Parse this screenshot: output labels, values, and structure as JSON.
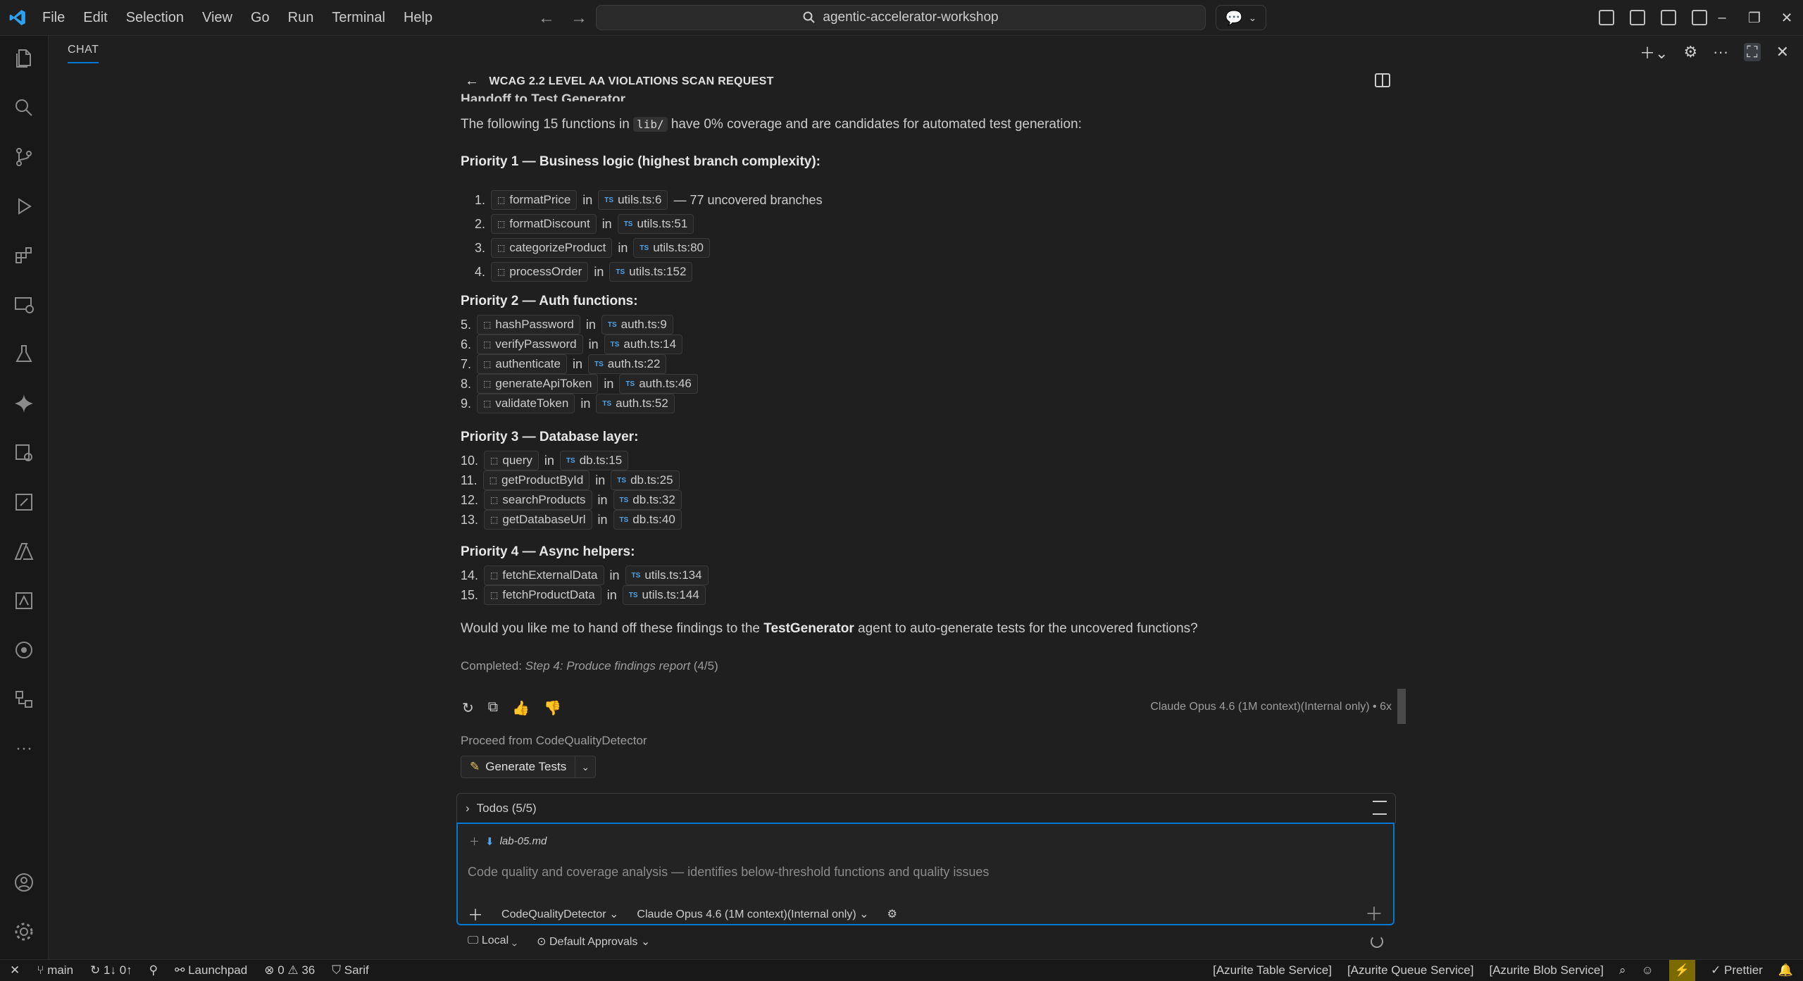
{
  "titlebar": {
    "menu": [
      "File",
      "Edit",
      "Selection",
      "View",
      "Go",
      "Run",
      "Terminal",
      "Help"
    ],
    "search_text": "agentic-accelerator-workshop"
  },
  "chat": {
    "tab_label": "CHAT",
    "session_title": "WCAG 2.2 LEVEL AA VIOLATIONS SCAN REQUEST",
    "partial_heading": "Handoff to Test Generator",
    "intro_pre": "The following 15 functions in ",
    "intro_code": "lib/",
    "intro_post": " have 0% coverage and are candidates for automated test generation:",
    "priority1_heading": "Priority 1 — Business logic (highest branch complexity):",
    "priority2_heading": "Priority 2 — Auth functions:",
    "priority3_heading": "Priority 3 — Database layer:",
    "priority4_heading": "Priority 4 — Async helpers:",
    "in_word": "in",
    "items": [
      {
        "num": "1.",
        "fn": "formatPrice",
        "file": "utils.ts:6",
        "note": "— 77 uncovered branches"
      },
      {
        "num": "2.",
        "fn": "formatDiscount",
        "file": "utils.ts:51",
        "note": ""
      },
      {
        "num": "3.",
        "fn": "categorizeProduct",
        "file": "utils.ts:80",
        "note": ""
      },
      {
        "num": "4.",
        "fn": "processOrder",
        "file": "utils.ts:152",
        "note": ""
      },
      {
        "num": "5.",
        "fn": "hashPassword",
        "file": "auth.ts:9",
        "note": ""
      },
      {
        "num": "6.",
        "fn": "verifyPassword",
        "file": "auth.ts:14",
        "note": ""
      },
      {
        "num": "7.",
        "fn": "authenticate",
        "file": "auth.ts:22",
        "note": ""
      },
      {
        "num": "8.",
        "fn": "generateApiToken",
        "file": "auth.ts:46",
        "note": ""
      },
      {
        "num": "9.",
        "fn": "validateToken",
        "file": "auth.ts:52",
        "note": ""
      },
      {
        "num": "10.",
        "fn": "query",
        "file": "db.ts:15",
        "note": ""
      },
      {
        "num": "11.",
        "fn": "getProductById",
        "file": "db.ts:25",
        "note": ""
      },
      {
        "num": "12.",
        "fn": "searchProducts",
        "file": "db.ts:32",
        "note": ""
      },
      {
        "num": "13.",
        "fn": "getDatabaseUrl",
        "file": "db.ts:40",
        "note": ""
      },
      {
        "num": "14.",
        "fn": "fetchExternalData",
        "file": "utils.ts:134",
        "note": ""
      },
      {
        "num": "15.",
        "fn": "fetchProductData",
        "file": "utils.ts:144",
        "note": ""
      }
    ],
    "question_pre": "Would you like me to hand off these findings to the ",
    "question_bold": "TestGenerator",
    "question_post": " agent to auto-generate tests for the uncovered functions?",
    "completed_label": "Completed: ",
    "completed_step": "Step 4: Produce findings report",
    "completed_count": " (4/5)",
    "model_note": "Claude Opus 4.6 (1M context)(Internal only) • 6x",
    "proceed_text": "Proceed from CodeQualityDetector",
    "generate_button": "Generate Tests"
  },
  "input": {
    "todos_label": "Todos (5/5)",
    "attachment": "lab-05.md",
    "placeholder": "Code quality and coverage analysis — identifies below-threshold functions and quality issues",
    "agent": "CodeQualityDetector",
    "model": "Claude Opus 4.6 (1M context)(Internal only)",
    "location": "Local",
    "approvals": "Default Approvals"
  },
  "statusbar": {
    "branch": "main",
    "sync": "1↓ 0↑",
    "launchpad": "Launchpad",
    "errors": "0",
    "warnings": "36",
    "sarif": "Sarif",
    "azurite_table": "[Azurite Table Service]",
    "azurite_queue": "[Azurite Queue Service]",
    "azurite_blob": "[Azurite Blob Service]",
    "prettier": "Prettier"
  },
  "colors": {
    "accent": "#0078d4",
    "background": "#1f1f1f",
    "ts_badge": "#4fa3e8"
  }
}
